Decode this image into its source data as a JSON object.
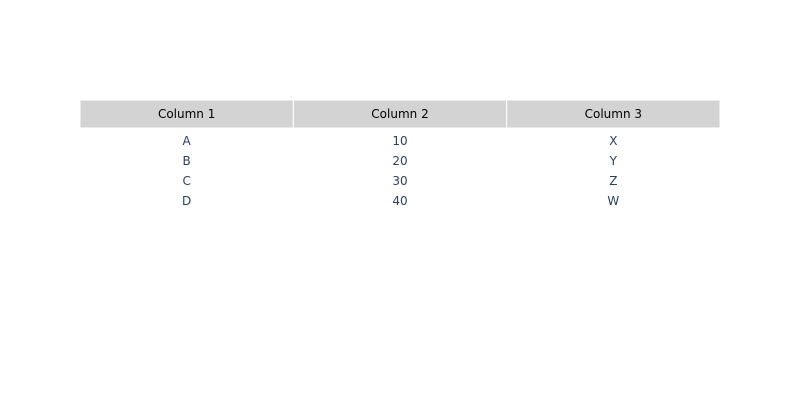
{
  "chart_data": {
    "type": "table",
    "columns": [
      "Column 1",
      "Column 2",
      "Column 3"
    ],
    "rows": [
      [
        "A",
        "10",
        "X"
      ],
      [
        "B",
        "20",
        "Y"
      ],
      [
        "C",
        "30",
        "Z"
      ],
      [
        "D",
        "40",
        "W"
      ]
    ]
  },
  "colors": {
    "header_fill": "#d3d3d3",
    "header_text": "#000000",
    "cell_text": "#2a3f5f",
    "divider": "#ffffff"
  }
}
